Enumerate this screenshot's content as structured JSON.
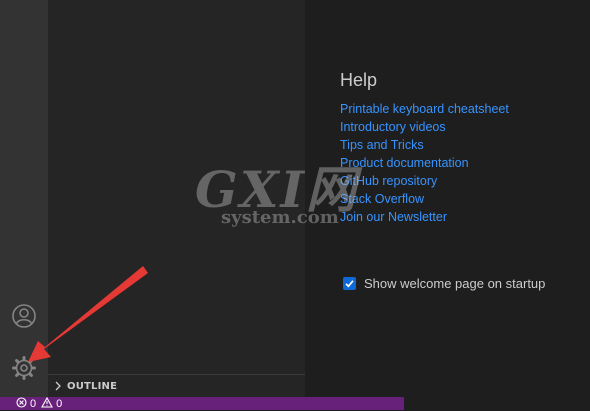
{
  "activity_bar": {
    "icons": [
      "account-icon",
      "settings-gear-icon"
    ]
  },
  "sidebar": {
    "outline_label": "OUTLINE"
  },
  "welcome": {
    "help_heading": "Help",
    "help_links": [
      "Printable keyboard cheatsheet",
      "Introductory videos",
      "Tips and Tricks",
      "Product documentation",
      "GitHub repository",
      "Stack Overflow",
      "Join our Newsletter"
    ],
    "startup_label": "Show welcome page on startup",
    "startup_checked": true
  },
  "status_bar": {
    "errors": "0",
    "warnings": "0"
  },
  "watermark": {
    "logo": "GXI网",
    "sub": "system.com"
  },
  "colors": {
    "status_bar": "#68217a",
    "link": "#3794ff",
    "annotation_arrow": "#e53935"
  }
}
